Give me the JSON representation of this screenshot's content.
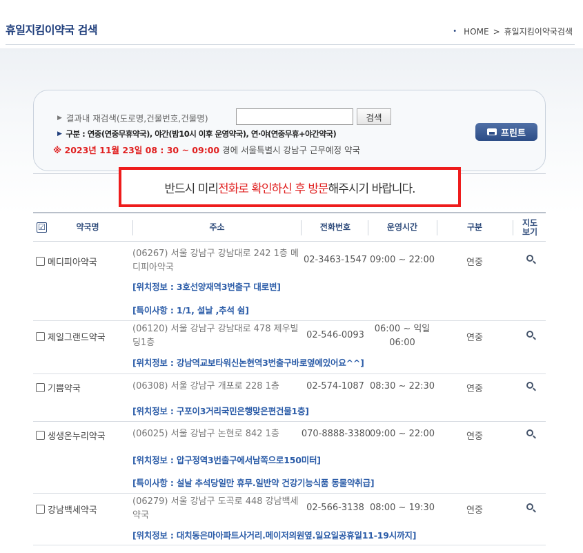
{
  "page": {
    "title": "휴일지킴이약국 검색",
    "breadcrumb": [
      "HOME",
      ">",
      "휴일지킴이약국검색"
    ]
  },
  "search": {
    "label": "결과내 재검색(도로명,건물번호,건물명)",
    "input_value": "",
    "button": "검색",
    "legend_bold_prefix": "구분 : 연중",
    "legend_text": "(연중무휴약국), 야간(밤10시 이후 운영약국), 연·야(연중무휴+야간약국)",
    "date_text": "※ 2023년 11월 23일 08 : 30 ~ 09:00",
    "date_rest": "경에  서울특별시  강남구   근무예정  약국",
    "print_button": "프린트"
  },
  "notice": {
    "part1": "반드시 미리 ",
    "part2": "전화로 확인하신 후 방문",
    "part3": "해주시기 바랍니다."
  },
  "table": {
    "headers": {
      "check": "☑",
      "name": "약국명",
      "address": "주소",
      "phone": "전화번호",
      "hours": "운영시간",
      "type": "구분",
      "map": "지도 보기"
    },
    "rows": [
      {
        "name": "메디피아약국",
        "address": "(06267) 서울 강남구 강남대로 242 1층 메디피아약국",
        "phone": "02-3463-1547",
        "hours": "09:00 ~ 22:00",
        "type": "연중",
        "location": "[위치정보 : 3호선양재역3번출구 대로변]",
        "special": "[특이사항 : 1/1, 설날 ,추석 쉼]"
      },
      {
        "name": "제일그랜드약국",
        "address": "(06120) 서울 강남구 강남대로 478 제우빌딩1층",
        "phone": "02-546-0093",
        "hours": "06:00 ~ 익일 06:00",
        "type": "연중",
        "location": "[위치정보 : 강남역교보타워신논현역3번출구바로옆에있어요^^]",
        "special": ""
      },
      {
        "name": "기쁨약국",
        "address": "(06308) 서울 강남구 개포로 228 1층",
        "phone": "02-574-1087",
        "hours": "08:30 ~ 22:30",
        "type": "연중",
        "location": "[위치정보 : 구포이3거리국민은행맞은편건물1층]",
        "special": ""
      },
      {
        "name": "생생온누리약국",
        "address": "(06025) 서울 강남구 논현로 842 1층",
        "phone": "070-8888-3380",
        "hours": "09:00 ~ 22:00",
        "type": "연중",
        "location": "[위치정보 : 압구정역3번출구에서남쪽으로150미터]",
        "special": "[특이사항 : 설날 추석당일만 휴무.일반약 건강기능식품 동물약취급]"
      },
      {
        "name": "강남백세약국",
        "address": "(06279) 서울 강남구 도곡로 448 강남백세약국",
        "phone": "02-566-3138",
        "hours": "08:00 ~ 19:30",
        "type": "연중",
        "location": "[위치정보 : 대치동은마아파트사거리.메이저의원옆.일요일공휴일11-19시까지]",
        "special": ""
      }
    ]
  },
  "icons": {
    "map": "magnifier-icon",
    "print": "printer-icon"
  },
  "colors": {
    "title": "#1f3e7c",
    "alert": "#e02020",
    "link": "#2b5ca8",
    "notice_border": "#ee1c1c"
  }
}
